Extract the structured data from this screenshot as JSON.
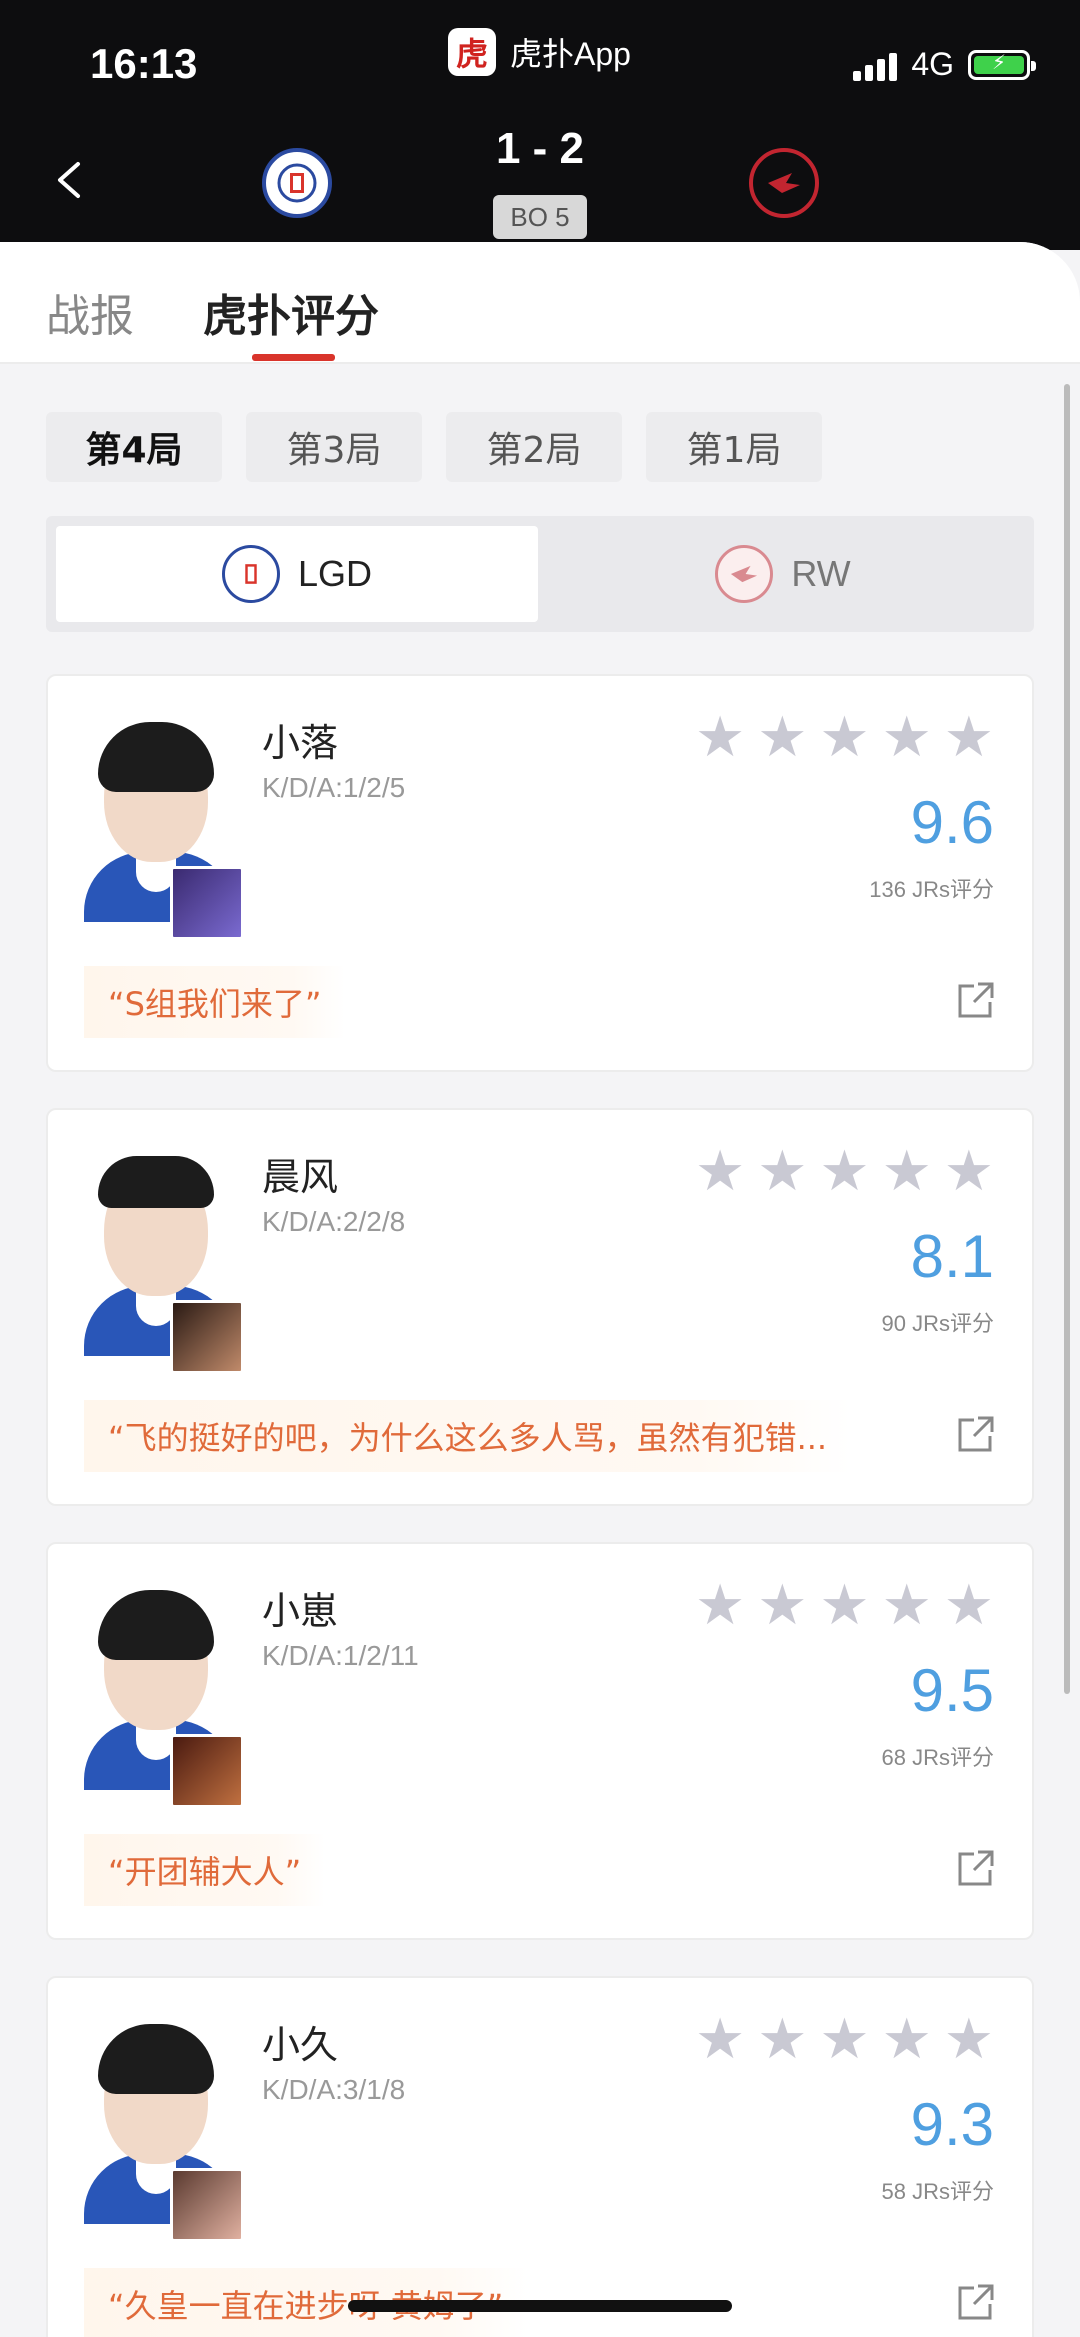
{
  "status_bar": {
    "time": "16:13",
    "app_name": "虎扑App",
    "app_logo_text": "虎",
    "network": "4G"
  },
  "match": {
    "score": "1 - 2",
    "format": "BO 5",
    "home_team": "LGD",
    "away_team": "RW"
  },
  "tabs": [
    {
      "label": "战报"
    },
    {
      "label": "虎扑评分"
    }
  ],
  "games": [
    {
      "label": "第4局"
    },
    {
      "label": "第3局"
    },
    {
      "label": "第2局"
    },
    {
      "label": "第1局"
    }
  ],
  "team_switch": {
    "lgd": "LGD",
    "rw": "RW"
  },
  "players": [
    {
      "name": "小落",
      "kda": "K/D/A:1/2/5",
      "rating": "9.6",
      "votes": "136 JRs评分",
      "comment": "“S组我们来了”",
      "hero_color": "#5a4aa0"
    },
    {
      "name": "晨风",
      "kda": "K/D/A:2/2/8",
      "rating": "8.1",
      "votes": "90 JRs评分",
      "comment": "“飞的挺好的吧，为什么这么多人骂，虽然有犯错...",
      "hero_color": "#6b4a3a"
    },
    {
      "name": "小崽",
      "kda": "K/D/A:1/2/11",
      "rating": "9.5",
      "votes": "68 JRs评分",
      "comment": "“开团辅大人”",
      "hero_color": "#8a3a2a"
    },
    {
      "name": "小久",
      "kda": "K/D/A:3/1/8",
      "rating": "9.3",
      "votes": "58 JRs评分",
      "comment": "“久皇一直在进步呀 黄姆了”",
      "hero_color": "#9a6a5a"
    }
  ],
  "colors": {
    "accent": "#d9342b",
    "rating_blue": "#4f9fe0",
    "lgd_blue": "#2b4aa0",
    "rw_red": "#c22530"
  }
}
